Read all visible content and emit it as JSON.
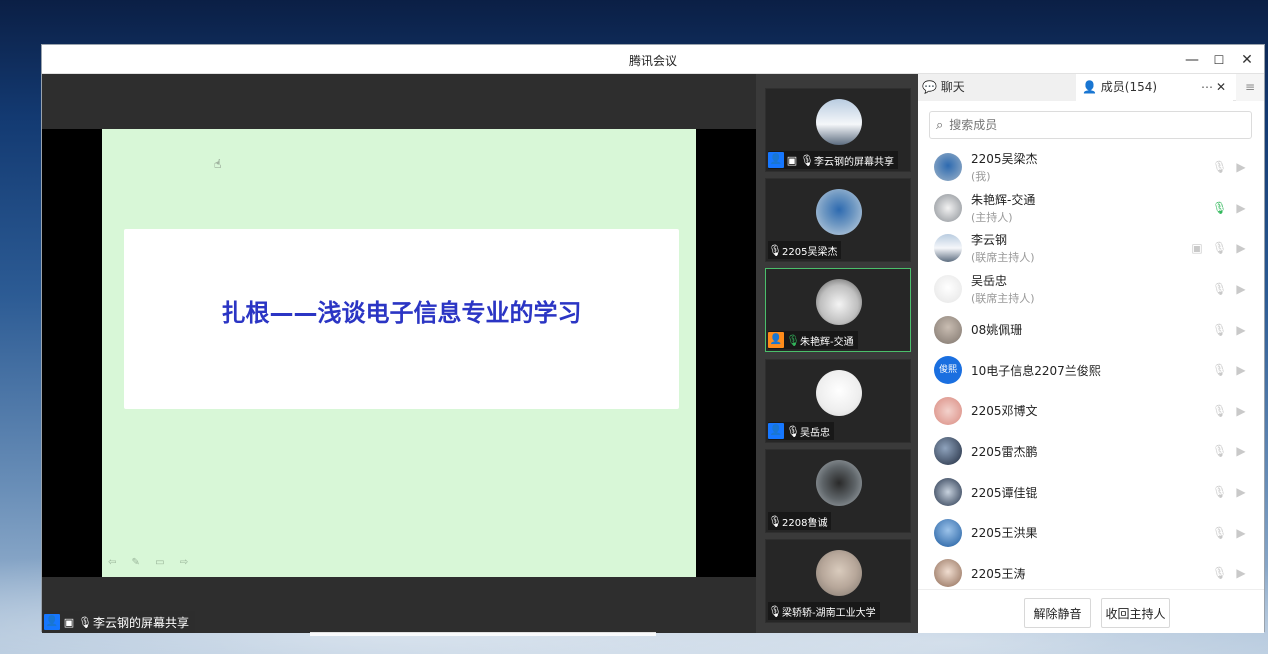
{
  "window": {
    "title": "腾讯会议",
    "controls": {
      "minimize": "—",
      "maximize": "☐",
      "close": "✕"
    }
  },
  "slide": {
    "title": "扎根——浅谈电子信息专业的学习",
    "tools": "⇦ ✎ ▭ ⇨"
  },
  "share_label": "李云钢的屏幕共享",
  "thumbnails": [
    {
      "label": "李云钢的屏幕共享",
      "avatar_color": "#6f8aa6"
    },
    {
      "label": "2205吴梁杰",
      "avatar_color": "#5b7fa4"
    },
    {
      "label": "朱艳辉-交通",
      "avatar_color": "#8a8f95"
    },
    {
      "label": "吴岳忠",
      "avatar_color": "#e6e6e6"
    },
    {
      "label": "2208鲁诚",
      "avatar_color": "#555b60"
    },
    {
      "label": "梁轿轿-湖南工业大学",
      "avatar_color": "#b7a79a"
    }
  ],
  "panel": {
    "tab_chat": "聊天",
    "tab_members": "成员(154)",
    "tab_more": "⋯",
    "tab_close": "✕",
    "tab_menu": "≡",
    "search_placeholder": "搜索成员",
    "members": [
      {
        "name": "2205吴梁杰",
        "role": "(我)",
        "avatar_color": "#5b7fa4",
        "mic": "muted"
      },
      {
        "name": "朱艳辉-交通",
        "role": "(主持人)",
        "avatar_color": "#8a8f95",
        "mic": "on"
      },
      {
        "name": "李云钢",
        "role": "(联席主持人)",
        "avatar_color": "#7a93ad",
        "mic": "off"
      },
      {
        "name": "吴岳忠",
        "role": "(联席主持人)",
        "avatar_color": "#efefef",
        "mic": "muted"
      },
      {
        "name": "08姚佩珊",
        "role": "",
        "avatar_color": "#9a8f86",
        "mic": "muted"
      },
      {
        "name": "10电子信息2207兰俊熙",
        "role": "",
        "avatar_color": "#1a6fe0",
        "avatar_text": "俊熙",
        "mic": "muted"
      },
      {
        "name": "2205邓博文",
        "role": "",
        "avatar_color": "#e0a19a",
        "mic": "muted"
      },
      {
        "name": "2205雷杰鹏",
        "role": "",
        "avatar_color": "#2f3d55",
        "mic": "muted"
      },
      {
        "name": "2205谭佳锟",
        "role": "",
        "avatar_color": "#34485f",
        "mic": "muted"
      },
      {
        "name": "2205王洪果",
        "role": "",
        "avatar_color": "#2c6fb5",
        "mic": "muted"
      },
      {
        "name": "2205王涛",
        "role": "",
        "avatar_color": "#c9a58e",
        "mic": "muted"
      }
    ],
    "unmute_all": "解除静音",
    "reclaim_host": "收回主持人"
  }
}
